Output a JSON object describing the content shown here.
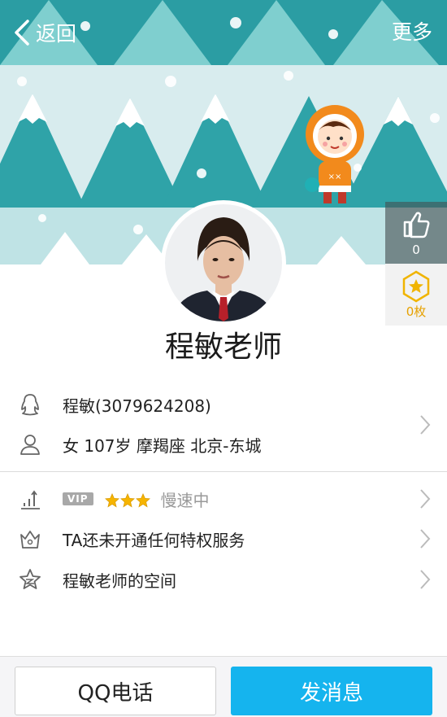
{
  "topbar": {
    "back_label": "返回",
    "more_label": "更多"
  },
  "sidebar": {
    "like_count": "0",
    "medal_count": "0枚"
  },
  "profile": {
    "name": "程敏老师",
    "qq_line": "程敏(3079624208)",
    "details_line": "女  107岁  摩羯座  北京-东城"
  },
  "services": {
    "vip_badge": "VIP",
    "vip_stars": 3,
    "vip_status": "慢速中",
    "privilege_text": "TA还未开通任何特权服务",
    "space_text": "程敏老师的空间"
  },
  "actions": {
    "call_label": "QQ电话",
    "message_label": "发消息"
  },
  "colors": {
    "accent": "#15b4ee",
    "banner_tree": "#2fa3a8",
    "banner_bg": "#d8ecee",
    "medal": "#f0b400"
  },
  "icons": [
    "back-chevron-icon",
    "thumbs-up-icon",
    "medal-star-icon",
    "qq-penguin-icon",
    "person-icon",
    "signal-bars-icon",
    "crown-icon",
    "star-space-icon",
    "chevron-right-icon"
  ]
}
